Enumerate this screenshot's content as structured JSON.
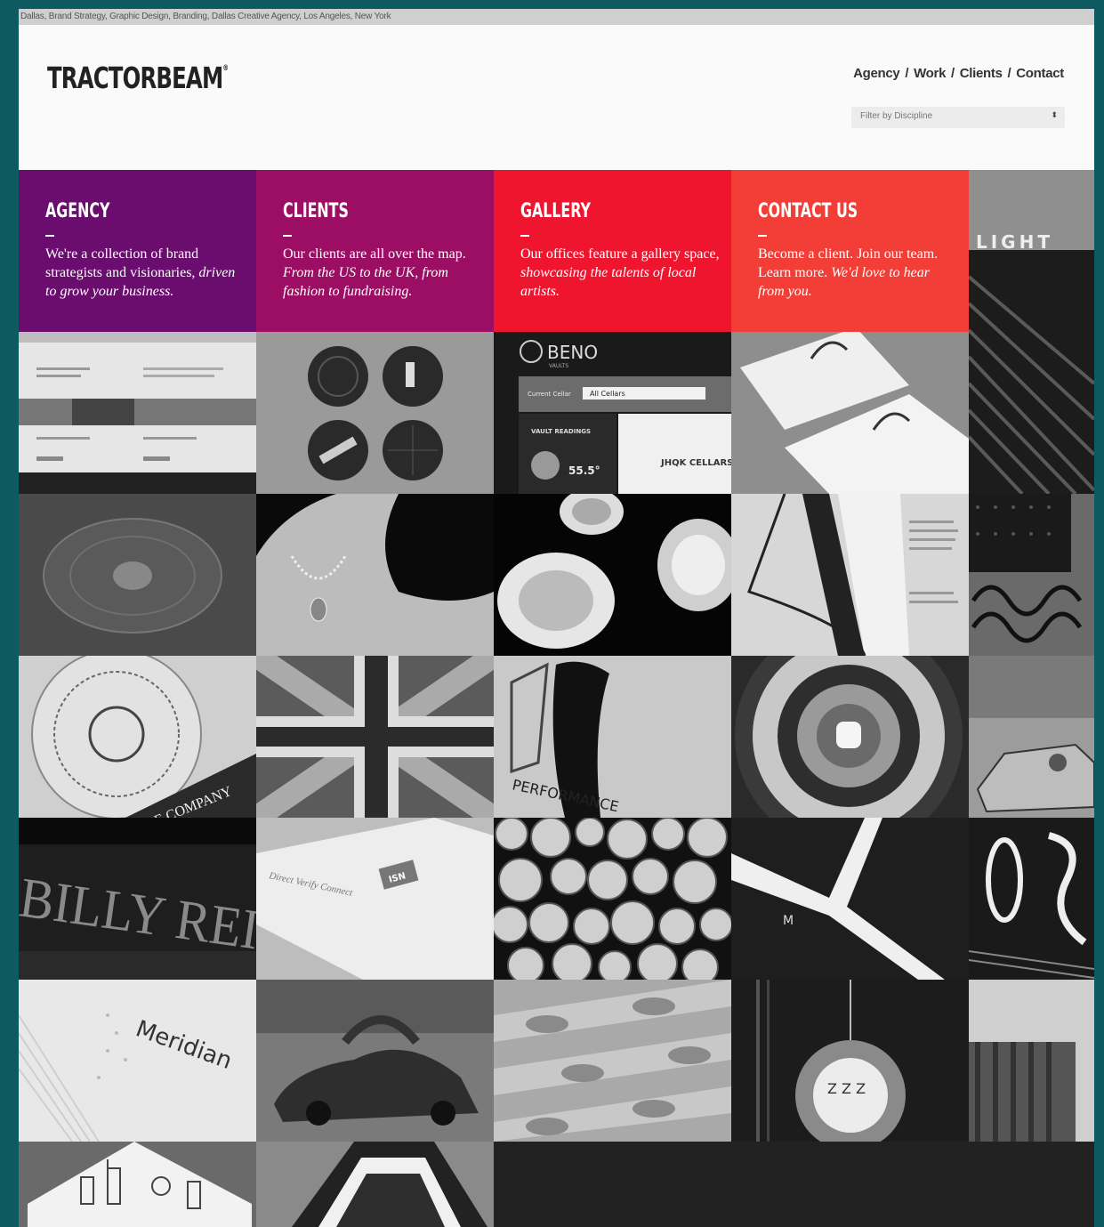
{
  "top_bar": {
    "keywords": "Dallas, Brand Strategy, Graphic Design, Branding, Dallas Creative Agency, Los Angeles, New York"
  },
  "header": {
    "logo": "TRACTORBEAM",
    "logo_mark": "®",
    "nav": [
      "Agency",
      "Work",
      "Clients",
      "Contact"
    ],
    "filter": {
      "label": "Filter by Discipline"
    }
  },
  "info_tiles": [
    {
      "title": "AGENCY",
      "text": "We're a collection of brand strategists and visionaries,",
      "emphasis": "driven to grow your business.",
      "color": "#6a0d6e"
    },
    {
      "title": "CLIENTS",
      "text": "Our clients are all over the map.",
      "emphasis": "From the US to the UK, from fashion to fundraising.",
      "color": "#9c0e63"
    },
    {
      "title": "GALLERY",
      "text": "Our offices feature a gallery space,",
      "emphasis": "showcasing the talents of local artists.",
      "color": "#f0152f"
    },
    {
      "title": "CONTACT US",
      "text": "Become a client. Join our team. Learn more.",
      "emphasis": "We'd love to hear from you.",
      "color": "#f23e36"
    }
  ],
  "portfolio_text": {
    "light": "LIGHT",
    "beno": "BENO",
    "beno_sub": "VAULTS",
    "all_cellars": "All Cellars",
    "current_cellar": "Current Cellar",
    "vault_readings": "VAULT READINGS",
    "temp": "55.5°",
    "cellar": "JHQK CELLARS",
    "billy_reid": "BILLY REID",
    "meridian": "Meridian",
    "direct": "Direct Verify Connect",
    "isn": "ISN",
    "performance": "PERFORMANCE",
    "company": "E COMPANY",
    "zzz": "Z Z Z"
  }
}
